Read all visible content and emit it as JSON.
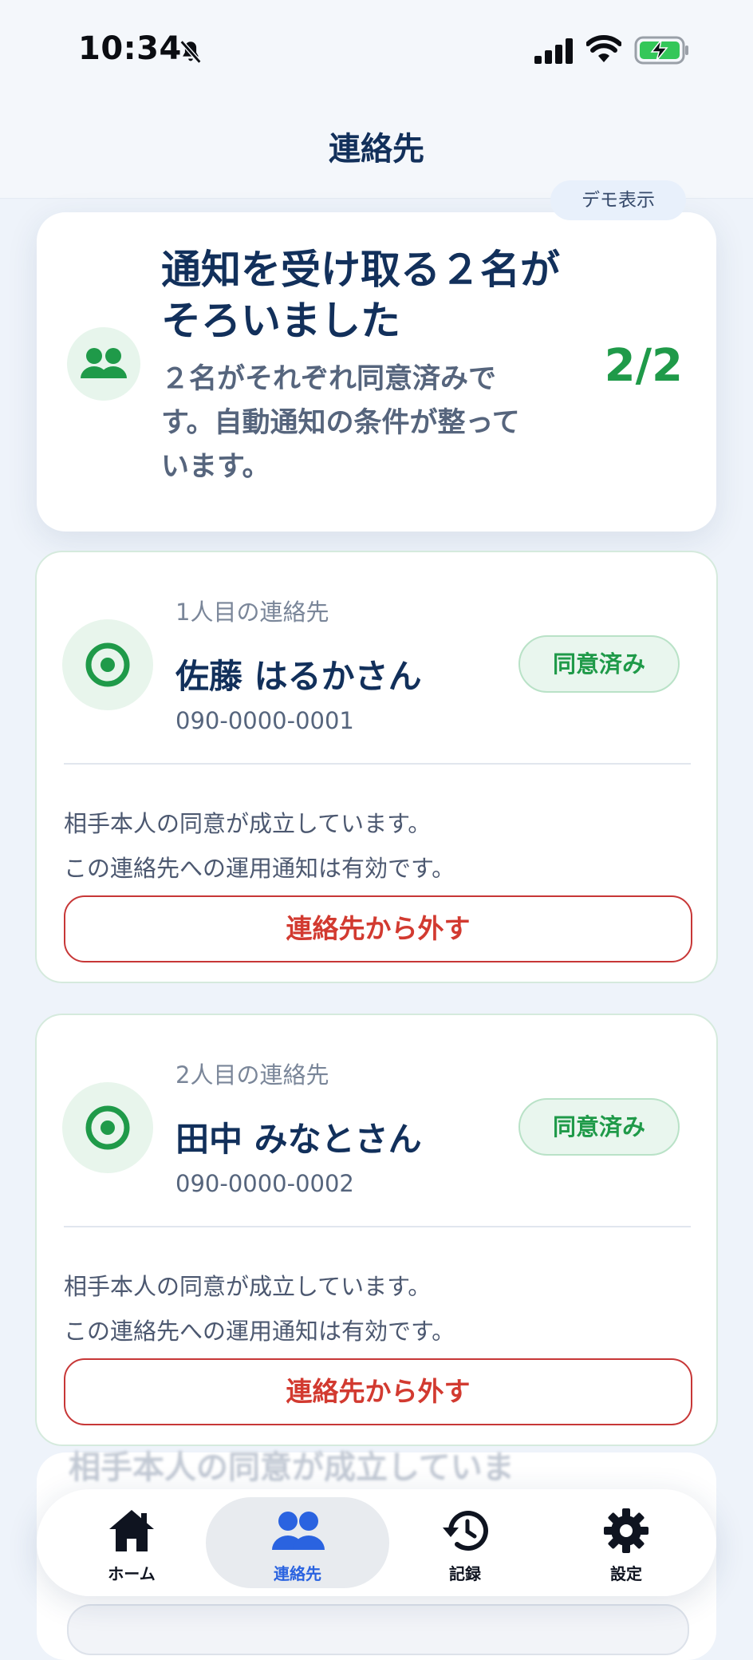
{
  "status_bar": {
    "time": "10:34"
  },
  "header": {
    "title": "連絡先"
  },
  "summary": {
    "demo_badge": "デモ表示",
    "title": "通知を受け取る２名がそろいました",
    "description": "２名がそれぞれ同意済みです。自動通知の条件が整っています。",
    "count": "2/2"
  },
  "contacts": [
    {
      "order_label": "1人目の連絡先",
      "name": "佐藤 はるかさん",
      "phone": "090-0000-0001",
      "status": "同意済み",
      "note_line1": "相手本人の同意が成立しています。",
      "note_line2": "この連絡先への運用通知は有効です。",
      "remove_label": "連絡先から外す"
    },
    {
      "order_label": "2人目の連絡先",
      "name": "田中 みなとさん",
      "phone": "090-0000-0002",
      "status": "同意済み",
      "note_line1": "相手本人の同意が成立しています。",
      "note_line2": "この連絡先への運用通知は有効です。",
      "remove_label": "連絡先から外す"
    }
  ],
  "background_text": "相手本人の同意が成立していま",
  "tab_bar": {
    "items": [
      {
        "label": "ホーム",
        "icon": "home-icon"
      },
      {
        "label": "連絡先",
        "icon": "contacts-icon",
        "active": true
      },
      {
        "label": "記録",
        "icon": "history-icon"
      },
      {
        "label": "設定",
        "icon": "gear-icon"
      }
    ]
  },
  "colors": {
    "accent_green": "#1f9a49",
    "danger_red": "#d23a30",
    "tab_active_blue": "#2a63e0",
    "title_navy": "#12305b"
  }
}
